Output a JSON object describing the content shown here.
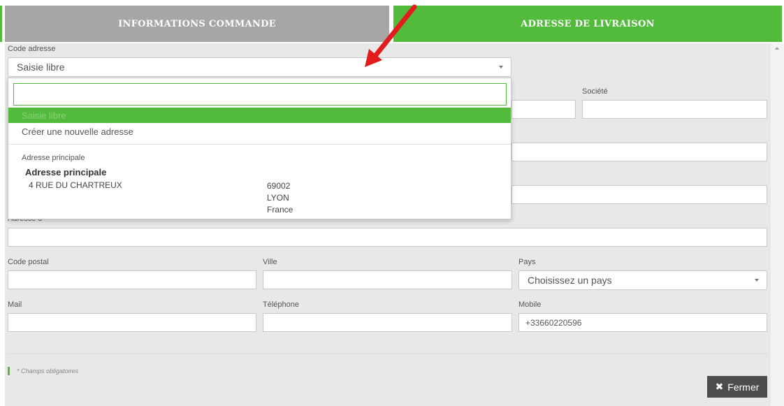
{
  "tabs": {
    "info": "INFORMATIONS COMMANDE",
    "address": "ADRESSE DE LIVRAISON"
  },
  "form": {
    "code_label": "Code adresse",
    "code_value": "Saisie libre",
    "societe_label": "Société",
    "adresse3_label": "Adresse 3",
    "cp_label": "Code postal",
    "ville_label": "Ville",
    "pays_label": "Pays",
    "pays_value": "Choisissez un pays",
    "mail_label": "Mail",
    "tel_label": "Téléphone",
    "mobile_label": "Mobile",
    "mobile_value": "+33660220596",
    "required_note": "* Champs obligatoires",
    "close_label": "Fermer",
    "close_icon": "close-icon"
  },
  "dropdown": {
    "search_value": "",
    "options": [
      "Saisie libre",
      "Créer une nouvelle adresse"
    ],
    "group_label": "Adresse principale",
    "address": {
      "name": "Adresse principale",
      "street": "4 RUE DU CHARTREUX",
      "postcode": "69002",
      "city": "LYON",
      "country": "France"
    }
  },
  "colors": {
    "accent": "#52bb3c",
    "tab_inactive": "#a6a6a6",
    "annotation_arrow": "#e21c1c"
  }
}
